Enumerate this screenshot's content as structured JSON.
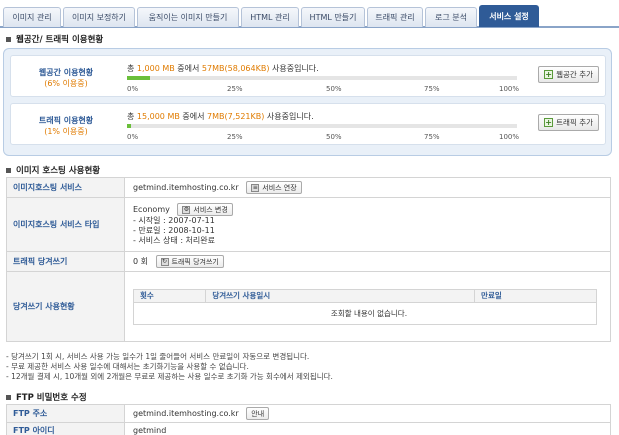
{
  "tabs": [
    {
      "label": "이미지 관리",
      "active": false
    },
    {
      "label": "이미지 보정하기",
      "active": false
    },
    {
      "label": "움직이는 이미지 만들기",
      "active": false
    },
    {
      "label": "HTML 관리",
      "active": false
    },
    {
      "label": "HTML 만들기",
      "active": false
    },
    {
      "label": "트래픽 관리",
      "active": false
    },
    {
      "label": "로그 분석",
      "active": false
    },
    {
      "label": "서비스 설정",
      "active": true
    }
  ],
  "usage_section": {
    "title": "웹공간/ 트래픽 이용현황",
    "web": {
      "label": "웹공간 이용현황",
      "pct_label": "(6% 이용중)",
      "text_prefix": "총 ",
      "total": "1,000 MB",
      "text_mid": " 중에서 ",
      "used": "57MB(58,064KB)",
      "text_suffix": " 사용중입니다.",
      "percent": 6,
      "button": "웹공간 추가"
    },
    "traffic": {
      "label": "트래픽 이용현황",
      "pct_label": "(1% 이용중)",
      "text_prefix": "총 ",
      "total": "15,000 MB",
      "text_mid": " 중에서 ",
      "used": "7MB(7,521KB)",
      "text_suffix": " 사용중입니다.",
      "percent": 1,
      "button": "트래픽 추가"
    },
    "ticks": [
      "0%",
      "25%",
      "50%",
      "75%",
      "100%"
    ]
  },
  "hosting_section": {
    "title": "이미지 호스팅 사용현황",
    "service_label": "이미지호스팅 서비스",
    "service_value": "getmind.itemhosting.co.kr",
    "extend_button": "서비스 연장",
    "type_label": "이미지호스팅 서비스 타입",
    "type_value": "Economy",
    "change_button": "서비스 변경",
    "start_date": "- 시작일 : 2007-07-11",
    "end_date": "- 만료일 : 2008-10-11",
    "status": "- 서비스 상태 : 처리완료",
    "pull_label": "트래픽 당겨쓰기",
    "pull_value": "0 회",
    "pull_button": "트래픽 당겨쓰기",
    "pull_status_label": "당겨쓰기 사용현황",
    "inner_headers": [
      "횟수",
      "당겨쓰기 사용일시",
      "만료일"
    ],
    "empty_message": "조회할 내용이 없습니다."
  },
  "notes": [
    "- 당겨쓰기 1회 시, 서비스 사용 가능 일수가 1일 줄어들어 서비스 만료일이 자동으로 변경됩니다.",
    "- 무료 제공한 서비스 사용 일수에 대해서는 초기화기능을 사용할 수 없습니다.",
    "- 12개월 결제 시, 10개월 외에 2개월은 무료로 제공하는 사용 일수로 초기화 가능 회수에서 제외됩니다."
  ],
  "ftp_section": {
    "title": "FTP 비밀번호 수정",
    "address_label": "FTP 주소",
    "address_value": "getmind.itemhosting.co.kr",
    "guide_button": "안내",
    "id_label": "FTP 아이디",
    "id_value": "getmind"
  }
}
